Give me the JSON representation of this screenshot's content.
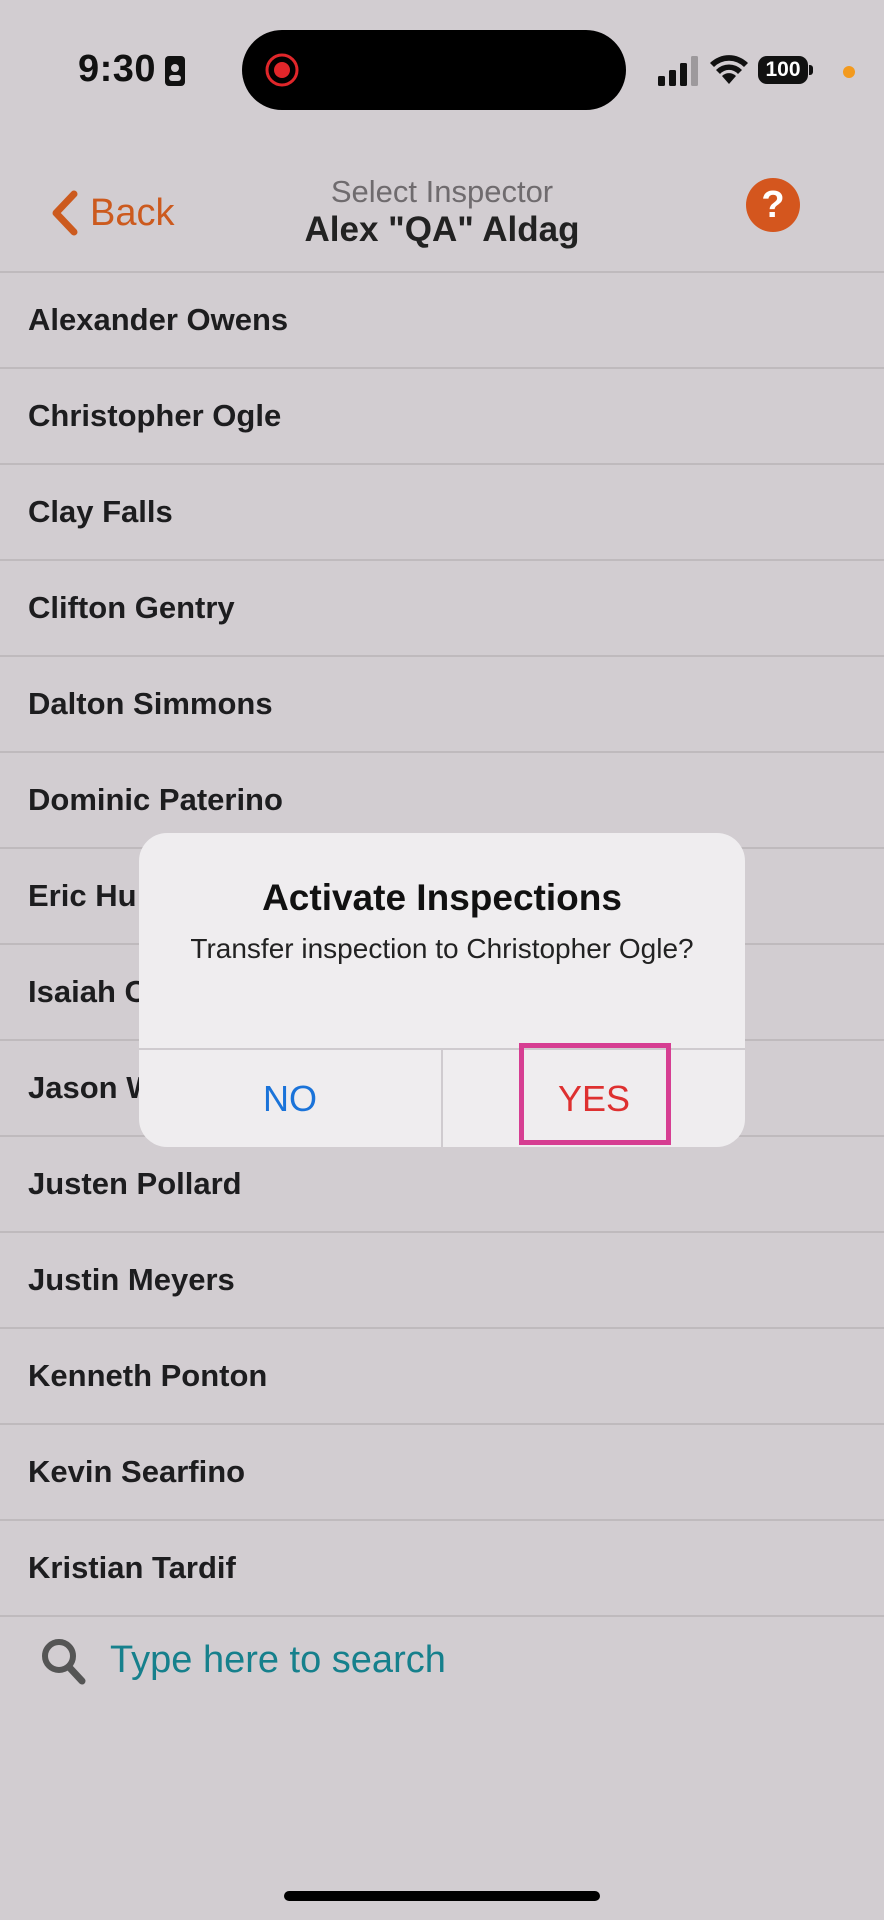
{
  "status_bar": {
    "time": "9:30",
    "battery": "100",
    "colors": {
      "dot": "#f39a1e"
    }
  },
  "nav": {
    "back_label": "Back",
    "subtitle": "Select Inspector",
    "title": "Alex \"QA\" Aldag",
    "help_label": "?",
    "accent_color": "#cc5a1e"
  },
  "inspectors": [
    "Alexander Owens",
    "Christopher Ogle",
    "Clay Falls",
    "Clifton Gentry",
    "Dalton Simmons",
    "Dominic Paterino",
    "Eric Hu",
    "Isaiah C",
    "Jason W",
    "Justen Pollard",
    "Justin Meyers",
    "Kenneth Ponton",
    "Kevin Searfino",
    "Kristian Tardif"
  ],
  "search": {
    "placeholder": "Type here to search",
    "value": ""
  },
  "dialog": {
    "title": "Activate Inspections",
    "message": "Transfer inspection to Christopher Ogle?",
    "no_label": "NO",
    "yes_label": "YES",
    "highlight_color": "#d63e92"
  }
}
